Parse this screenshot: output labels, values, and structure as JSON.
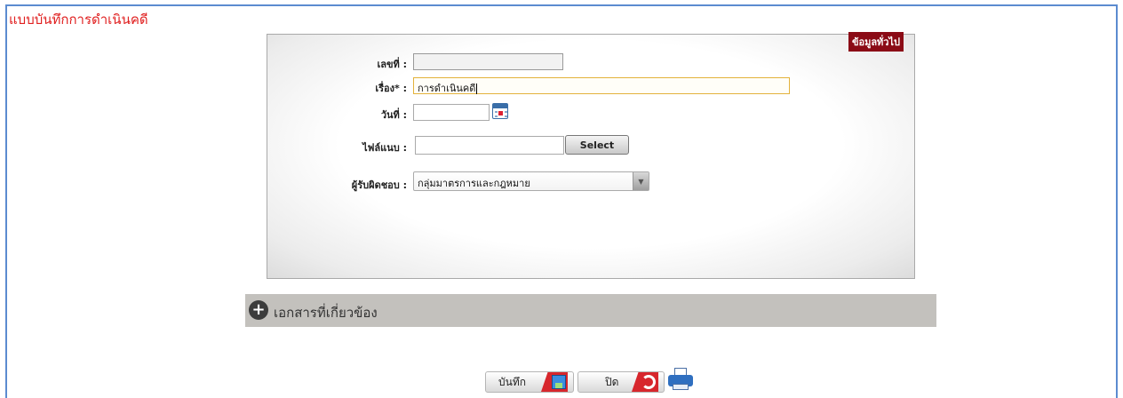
{
  "page": {
    "title": "แบบบันทึกการดำเนินคดี"
  },
  "general_panel": {
    "tag": "ข้อมูลทั่วไป",
    "fields": {
      "number": {
        "label": "เลขที่ :",
        "value": ""
      },
      "subject": {
        "label": "เรื่อง* :",
        "value": "การดำเนินคดี"
      },
      "date": {
        "label": "วันที่ :",
        "value": ""
      },
      "attachment": {
        "label": "ไฟล์แนบ :",
        "value": "",
        "button": "Select"
      },
      "responsible": {
        "label": "ผู้รับผิดชอบ :",
        "value": "กลุ่มมาตรการและกฎหมาย"
      }
    }
  },
  "related": {
    "label": "เอกสารที่เกี่ยวข้อง"
  },
  "actions": {
    "save_label": "บันทึก",
    "close_label": "ปิด"
  },
  "colors": {
    "title": "#e02020",
    "frame_border": "#5b8bd0",
    "panel_tag_bg": "#8b0b16",
    "active_border": "#e3b23b",
    "action_red": "#d7262c",
    "related_bar": "#c3c1bd"
  },
  "icons": {
    "calendar": "calendar-icon",
    "dropdown": "chevron-down-icon",
    "expand": "plus-circle-icon",
    "save": "save-icon",
    "close": "undo-icon",
    "print": "printer-icon"
  }
}
